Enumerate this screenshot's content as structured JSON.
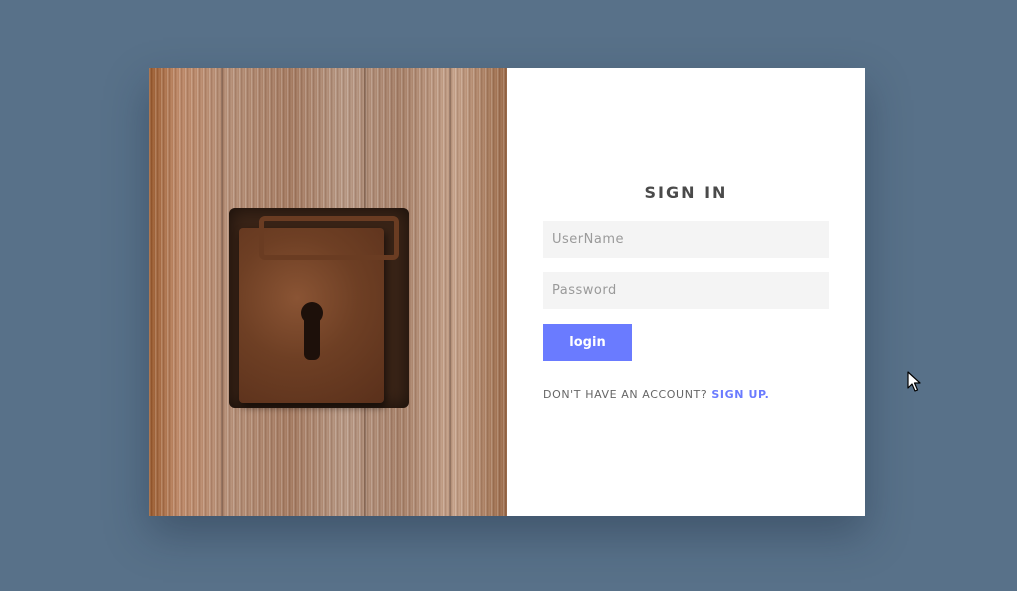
{
  "colors": {
    "background": "#587189",
    "card": "#ffffff",
    "accent": "#6a7bff",
    "input_bg": "#f4f4f4",
    "title_text": "#4a4a4a"
  },
  "image_panel": {
    "icon": "padlock-photo"
  },
  "form": {
    "title": "SIGN IN",
    "username": {
      "placeholder": "UserName",
      "value": ""
    },
    "password": {
      "placeholder": "Password",
      "value": ""
    },
    "login_label": "login",
    "signup_prompt": "DON'T HAVE AN ACCOUNT? ",
    "signup_link": "SIGN UP."
  },
  "cursor": {
    "icon": "arrow-cursor-icon"
  }
}
